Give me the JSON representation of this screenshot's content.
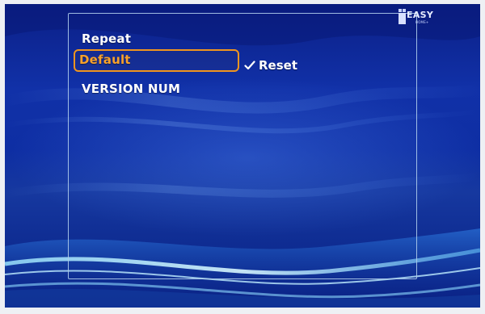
{
  "menu": {
    "items": [
      {
        "label": "Repeat"
      },
      {
        "label": "Default"
      },
      {
        "label": "VERSION NUM"
      }
    ],
    "selected_index": 1
  },
  "option": {
    "label": "Reset",
    "checked": true
  },
  "logo": {
    "word": "EASY",
    "sub": "HOME+"
  },
  "colors": {
    "selection_border": "#f0951e",
    "selection_text": "#f7a12a",
    "frame_border": "#afcdeb",
    "background_top": "#0b1f86",
    "background_bottom": "#0a2183"
  },
  "icons": {
    "option_mark": "check-icon",
    "logo_mark": "logo-icon"
  }
}
